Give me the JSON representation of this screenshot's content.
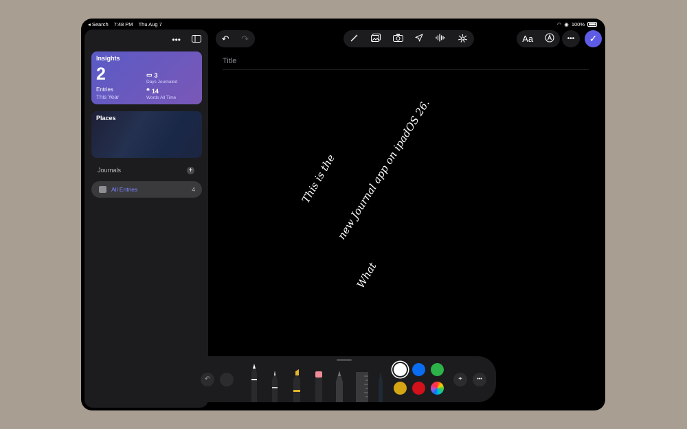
{
  "status": {
    "back_label": "◂ Search",
    "time": "7:48 PM",
    "date": "Thu Aug 7",
    "battery": "100%"
  },
  "sidebar": {
    "insights": {
      "title": "Insights",
      "entries_count": "2",
      "entries_label": "Entries",
      "entries_sub": "This Year",
      "days_value": "3",
      "days_label": "Days Journaled",
      "words_value": "14",
      "words_label": "Words All Time"
    },
    "places": {
      "title": "Places"
    },
    "journals_label": "Journals",
    "all_entries": {
      "label": "All Entries",
      "count": "4"
    }
  },
  "editor": {
    "title_placeholder": "Title",
    "handwriting": [
      "This is the",
      "new Journal app on ipadOS 26.",
      "What"
    ]
  },
  "toolbar": {
    "icons": [
      "undo-icon",
      "redo-icon",
      "magic-wand-icon",
      "photo-library-icon",
      "camera-icon",
      "location-icon",
      "audio-waveform-icon",
      "suggestions-icon",
      "text-format-icon",
      "markup-icon",
      "more-icon",
      "done-checkmark-icon"
    ],
    "text_format_label": "Aa",
    "accent_color": "#5e5ce6"
  },
  "palette": {
    "tools": [
      "pen",
      "monoline",
      "highlighter",
      "eraser",
      "pencil",
      "ruler",
      "fountain-pen"
    ],
    "colors": [
      "#ffffff",
      "#0a6cf0",
      "#2db24a",
      "#d4a614",
      "#d2111a",
      "rainbow"
    ],
    "selected_color": "#ffffff"
  }
}
